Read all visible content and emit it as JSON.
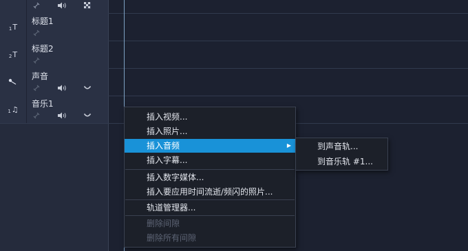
{
  "tracks": [
    {
      "type_number": "",
      "type_symbol": "",
      "name": ""
    },
    {
      "type_number": "1",
      "type_symbol": "T",
      "name": "标题1"
    },
    {
      "type_number": "2",
      "type_symbol": "T",
      "name": "标题2"
    },
    {
      "type_number": "",
      "type_symbol": "",
      "name": "声音"
    },
    {
      "type_number": "1",
      "type_symbol": "♫",
      "name": "音乐1"
    }
  ],
  "context_menu": {
    "items": [
      {
        "label": "插入视频..."
      },
      {
        "label": "插入照片..."
      },
      {
        "label": "插入音频"
      },
      {
        "label": "插入字幕..."
      },
      {
        "label": "插入数字媒体..."
      },
      {
        "label": "插入要应用时间流逝/频闪的照片..."
      },
      {
        "label": "轨道管理器..."
      },
      {
        "label": "删除间隙"
      },
      {
        "label": "删除所有间隙"
      }
    ],
    "submenu_arrow": "▶"
  },
  "audio_submenu": {
    "items": [
      {
        "label": "到声音轨..."
      },
      {
        "label": "到音乐轨 #1..."
      }
    ]
  },
  "colors": {
    "highlight": "#1992d8",
    "playhead": "#7ea2c4",
    "panel": "#2a3144"
  }
}
